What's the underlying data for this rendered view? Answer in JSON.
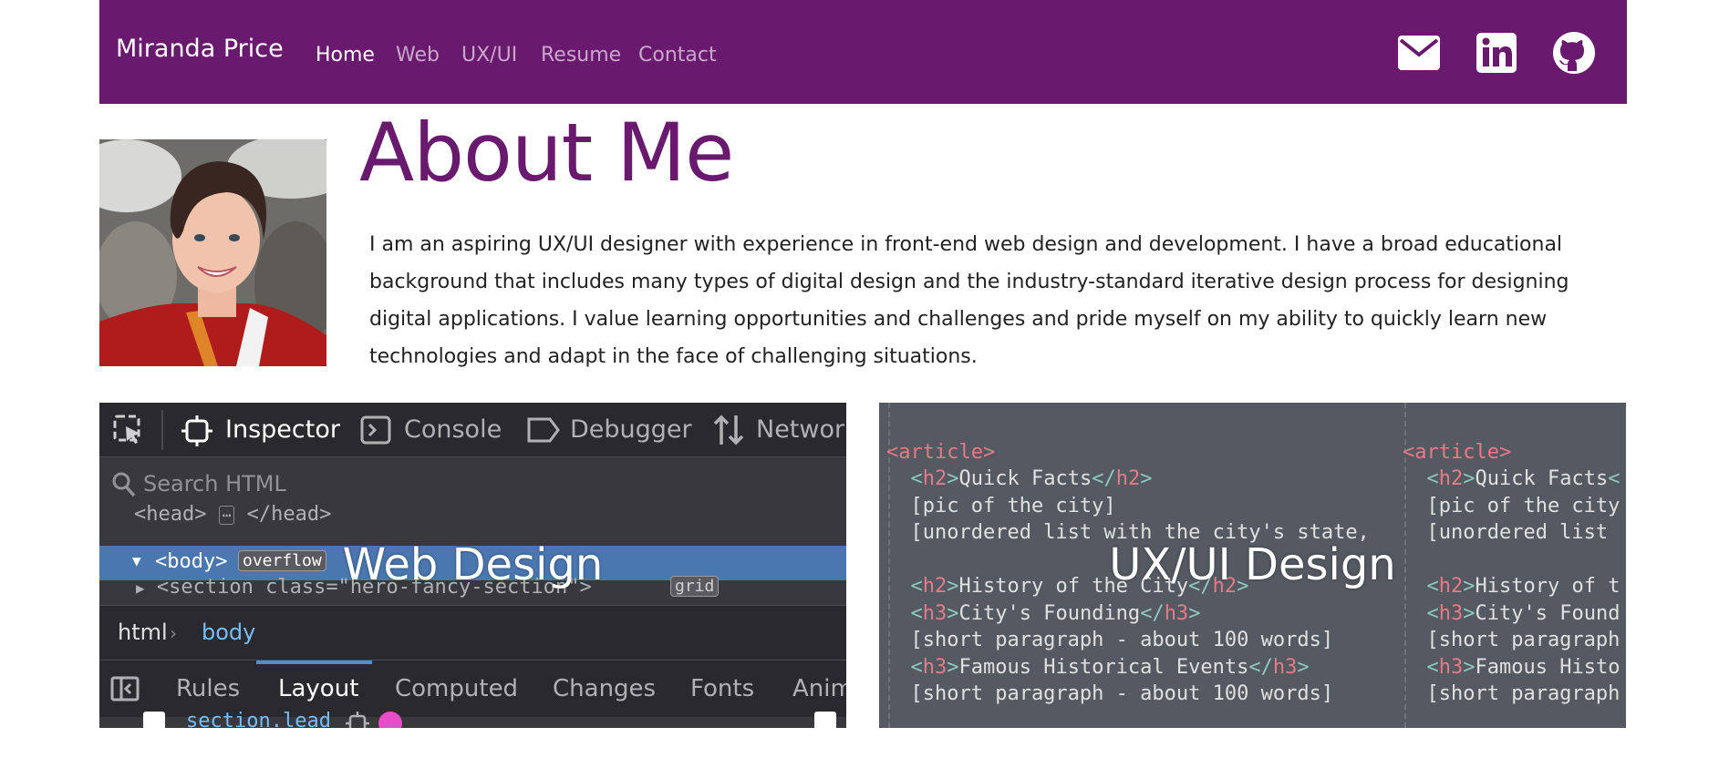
{
  "navbar": {
    "brand": "Miranda Price",
    "links": [
      {
        "label": "Home",
        "active": true
      },
      {
        "label": "Web",
        "active": false
      },
      {
        "label": "UX/UI",
        "active": false
      },
      {
        "label": "Resume",
        "active": false
      },
      {
        "label": "Contact",
        "active": false
      }
    ],
    "icons": [
      "mail-icon",
      "linkedin-icon",
      "github-icon"
    ]
  },
  "about": {
    "title": "About Me",
    "text": "I am an aspiring UX/UI designer with experience in front-end web design and development. I have a broad educational background that includes many types of digital design and the industry-standard iterative design process for designing digital applications. I value learning opportunities and challenges and pride myself on my ability to quickly learn new technologies and adapt in the face of challenging situations."
  },
  "cards": {
    "web": {
      "title": "Web Design",
      "devtools": {
        "tabs": [
          "Inspector",
          "Console",
          "Debugger",
          "Network"
        ],
        "search_placeholder": "Search HTML",
        "tree_head": "<head>",
        "tree_head_close": "</head>",
        "tree_body": "<body>",
        "tree_badge": "overflow",
        "tree_section": "<section class=\"hero-fancy-section\">",
        "tree_section_badge": "grid",
        "crumb_html": "html",
        "crumb_body": "body",
        "subtabs": [
          "Rules",
          "Layout",
          "Computed",
          "Changes",
          "Fonts",
          "Anim"
        ],
        "rule_selector": "section.lead"
      }
    },
    "ux": {
      "title": "UX/UI Design",
      "code_lines": [
        "<article>",
        "  <h2>Quick Facts</h2>",
        "  [pic of the city]",
        "  [unordered list with the city's state,",
        "",
        "  <h2>History of the City</h2>",
        "  <h3>City's Founding</h3>",
        "  [short paragraph - about 100 words]",
        "  <h3>Famous Historical Events</h3>",
        "  [short paragraph - about 100 words]",
        "",
        "<article>"
      ]
    }
  },
  "colors": {
    "primary": "#6a1a6e",
    "nav_inactive": "#c9a7cb",
    "devtools_bg": "#38383d",
    "devtools_highlight": "#4a77b0",
    "code_bg": "#545962"
  }
}
